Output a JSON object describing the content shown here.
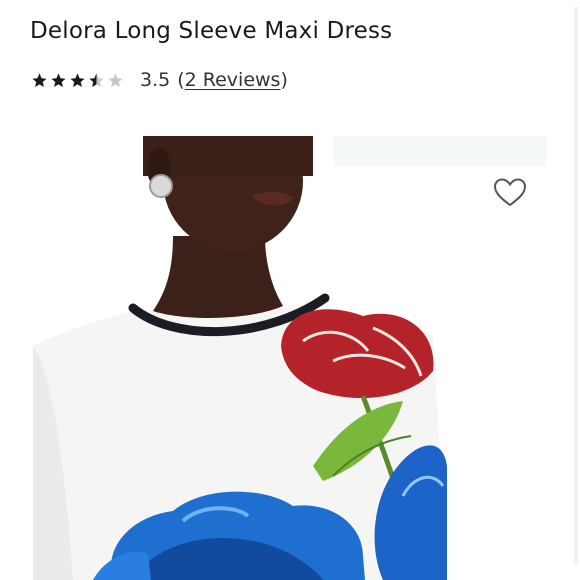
{
  "product": {
    "title": "Delora Long Sleeve Maxi Dress",
    "rating_value": "3.5",
    "rating_numeric": 3.5,
    "rating_max": 5,
    "reviews_open": "(",
    "reviews_link": "2 Reviews",
    "reviews_close": ")"
  },
  "image": {
    "wishlist_icon": "heart-outline-icon"
  },
  "colors": {
    "star_filled": "#1a1a1a",
    "star_empty": "#c8c8c8",
    "accent_blue": "#1f6fd1",
    "accent_red": "#b5232a"
  }
}
